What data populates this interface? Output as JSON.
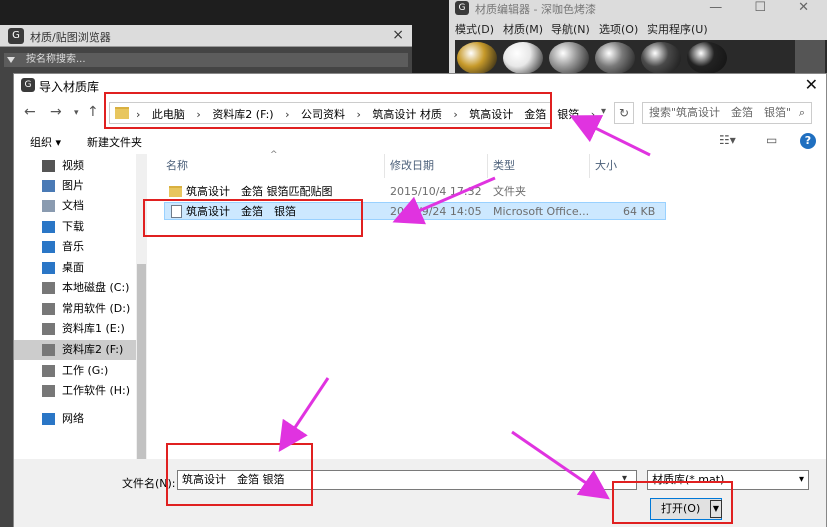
{
  "browser": {
    "title": "材质/贴图浏览器",
    "search_label": "按名称搜索..."
  },
  "editor": {
    "title": "材质编辑器 - 深咖色烤漆",
    "menu": [
      "模式(D)",
      "材质(M)",
      "导航(N)",
      "选项(O)",
      "实用程序(U)"
    ],
    "spheres": [
      "#c79a2a",
      "#e8e8e8",
      "#9a9a9a",
      "#7a7a7a",
      "#4a4a4a",
      "#222222"
    ]
  },
  "dialog": {
    "title": "导入材质库",
    "address": {
      "crumbs": [
        "此电脑",
        "资料库2 (F:)",
        "公司资料",
        "筑高设计 材质",
        "筑高设计　金箔　银箔"
      ]
    },
    "search_placeholder": "搜索\"筑高设计　金箔　银箔\"",
    "toolbar": {
      "organize": "组织 ▾",
      "new_folder": "新建文件夹"
    },
    "nav": [
      {
        "label": "视频",
        "color": "#555"
      },
      {
        "label": "图片",
        "color": "#4a7ab5"
      },
      {
        "label": "文档",
        "color": "#8a9bb0"
      },
      {
        "label": "下载",
        "color": "#2a76c6"
      },
      {
        "label": "音乐",
        "color": "#2a76c6"
      },
      {
        "label": "桌面",
        "color": "#2a76c6"
      },
      {
        "label": "本地磁盘 (C:)",
        "color": "#777"
      },
      {
        "label": "常用软件 (D:)",
        "color": "#777"
      },
      {
        "label": "资料库1 (E:)",
        "color": "#777"
      },
      {
        "label": "资料库2 (F:)",
        "color": "#777"
      },
      {
        "label": "工作 (G:)",
        "color": "#777"
      },
      {
        "label": "工作软件 (H:)",
        "color": "#777"
      },
      {
        "label": "网络",
        "color": "#2a76c6"
      }
    ],
    "columns": {
      "name": "名称",
      "date": "修改日期",
      "type": "类型",
      "size": "大小"
    },
    "files": [
      {
        "name": "筑高设计　金箔 银箔匹配贴图",
        "date": "2015/10/4 17:32",
        "type": "文件夹",
        "size": "",
        "kind": "folder"
      },
      {
        "name": "筑高设计　金箔　银箔",
        "date": "2015/9/24 14:05",
        "type": "Microsoft Office...",
        "size": "64 KB",
        "kind": "file"
      }
    ],
    "filename_label": "文件名(N):",
    "filename_value": "筑高设计　金箔 银箔",
    "filter_value": "材质库(*.mat)",
    "open_label": "打开(O)"
  }
}
